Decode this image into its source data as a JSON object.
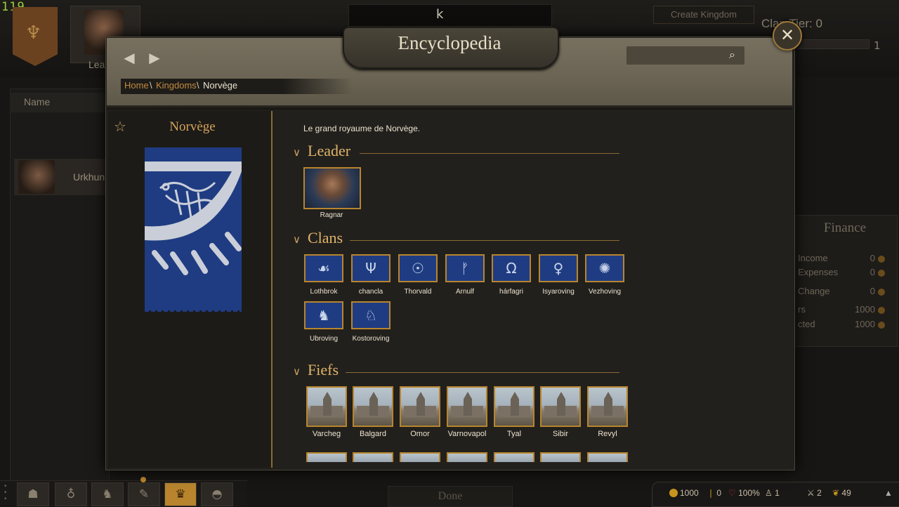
{
  "fps": "119",
  "background": {
    "search_value": "k",
    "create_kingdom": "Create Kingdom",
    "clan_tier": "Clan Tier: 0",
    "clan_tier_max": "1",
    "leader_tab_partial": "Lea",
    "name_header": "Name",
    "row_name": "Urkhun",
    "finance": {
      "title": "Finance",
      "rows": [
        {
          "label": "Income",
          "value": "0"
        },
        {
          "label": "Expenses",
          "value": "0"
        },
        {
          "label": "Change",
          "value": "0"
        },
        {
          "label": "rs",
          "value": "1000"
        },
        {
          "label": "cted",
          "value": "1000"
        }
      ]
    },
    "done": "Done",
    "status": {
      "gold": "1000",
      "influence": "0",
      "morale": "100%",
      "troops": "1",
      "speed": "2",
      "food": "49"
    }
  },
  "modal": {
    "title": "Encyclopedia",
    "close_glyph": "✕",
    "breadcrumb": [
      "Home",
      "Kingdoms",
      "Norvège"
    ],
    "kingdom_name": "Norvège",
    "description": "Le grand royaume de Norvège.",
    "sections": {
      "leader": "Leader",
      "clans": "Clans",
      "fiefs": "Fiefs"
    },
    "leader": {
      "name": "Ragnar"
    },
    "clans": [
      {
        "name": "Lothbrok",
        "icon": "raven-icon"
      },
      {
        "name": "chancla",
        "icon": "tree-icon"
      },
      {
        "name": "Thorvald",
        "icon": "helmet-icon"
      },
      {
        "name": "Arnulf",
        "icon": "rune-icon"
      },
      {
        "name": "hárfagri",
        "icon": "horseshoe-icon"
      },
      {
        "name": "Isyaroving",
        "icon": "figure-icon"
      },
      {
        "name": "Vezhoving",
        "icon": "sun-icon"
      },
      {
        "name": "Ubroving",
        "icon": "bear-icon"
      },
      {
        "name": "Kostoroving",
        "icon": "stag-icon"
      }
    ],
    "fiefs": [
      "Varcheg",
      "Balgard",
      "Omor",
      "Varnovapol",
      "Tyal",
      "Sibir",
      "Revyl"
    ]
  },
  "colors": {
    "accent_gold": "#b8852e",
    "banner_blue": "#1f3c82",
    "link": "#c28a40"
  }
}
